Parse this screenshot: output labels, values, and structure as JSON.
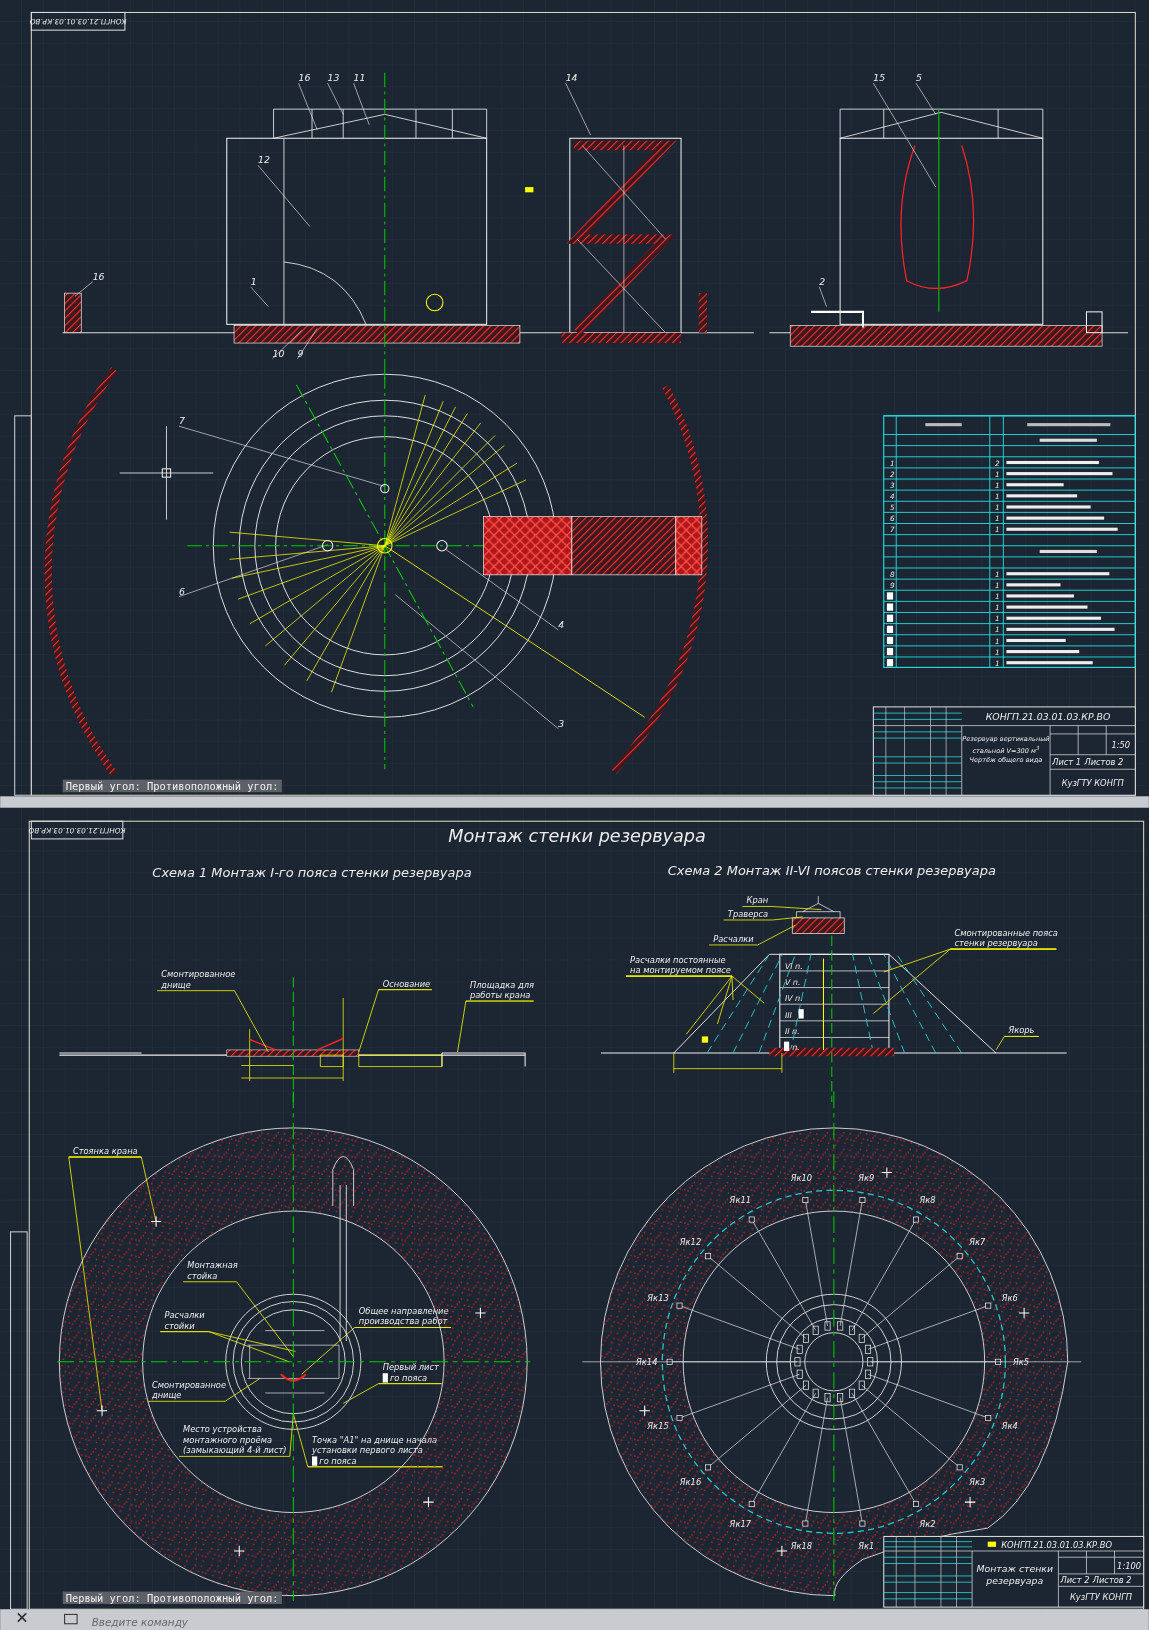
{
  "top_sheet": {
    "corner_stamp": "КОНГП.21.03.01.03.КР.ВО",
    "callouts": [
      "16",
      "13",
      "11",
      "14",
      "15",
      "5",
      "12",
      "1",
      "2",
      "16",
      "10",
      "9",
      "7",
      "6",
      "4",
      "3"
    ],
    "spec_table": {
      "rows": [
        {
          "kind": "header"
        },
        {
          "kind": "section"
        },
        {
          "kind": "blank"
        },
        {
          "kind": "item",
          "number": "1",
          "quantity": "2"
        },
        {
          "kind": "item",
          "number": "2",
          "quantity": "1"
        },
        {
          "kind": "item",
          "number": "3",
          "quantity": "1"
        },
        {
          "kind": "item",
          "number": "4",
          "quantity": "1"
        },
        {
          "kind": "item",
          "number": "5",
          "quantity": "1"
        },
        {
          "kind": "item",
          "number": "6",
          "quantity": "1"
        },
        {
          "kind": "item",
          "number": "7",
          "quantity": "1"
        },
        {
          "kind": "blank"
        },
        {
          "kind": "section"
        },
        {
          "kind": "blank"
        },
        {
          "kind": "item",
          "number": "8",
          "quantity": "1"
        },
        {
          "kind": "item",
          "number": "9",
          "quantity": "1"
        },
        {
          "kind": "masked",
          "quantity": "1"
        },
        {
          "kind": "masked",
          "quantity": "1"
        },
        {
          "kind": "masked",
          "quantity": "1"
        },
        {
          "kind": "masked",
          "quantity": "1"
        },
        {
          "kind": "masked",
          "quantity": "1"
        },
        {
          "kind": "masked",
          "quantity": "1"
        },
        {
          "kind": "masked",
          "quantity": "1"
        }
      ]
    },
    "title_block": {
      "code": "КОНГП.21.03.01.03.КР.ВО",
      "title": [
        "Резервуар вертикальный",
        "стальной V=300 м$^{3}$",
        "Чертёж общего вида"
      ],
      "scale": "1:50",
      "sheet": "Лист 1",
      "sheets": "Листов 2",
      "organization": "КузГТУ КОНГП"
    },
    "command_prompt": "Первый угол: Противоположный угол:"
  },
  "bottom_sheet": {
    "corner_stamp": "КОНГП.21.03.01.03.КР.ВО",
    "title": "Монтаж стенки резервуара",
    "scheme_1": {
      "title": "Схема 1 Монтаж I-го пояса стенки резервуара",
      "labels": [
        {
          "lines": [
            {
              "text": "Смонтированное",
              "masked": false
            },
            {
              "text": "днище",
              "masked": false
            }
          ]
        },
        {
          "lines": [
            {
              "text": "Основание",
              "masked": false
            }
          ]
        },
        {
          "lines": [
            {
              "text": "Площадка для",
              "masked": false
            },
            {
              "text": "работы крана",
              "masked": false
            }
          ]
        },
        {
          "lines": [
            {
              "text": "Стоянка крана",
              "masked": false
            }
          ]
        },
        {
          "lines": [
            {
              "text": "Монтажная",
              "masked": false
            },
            {
              "text": "стойка",
              "masked": false
            }
          ]
        },
        {
          "lines": [
            {
              "text": "Расчалки",
              "masked": false
            },
            {
              "text": "стойки",
              "masked": false
            }
          ]
        },
        {
          "lines": [
            {
              "text": "Общее направление",
              "masked": false
            },
            {
              "text": "производства работ",
              "masked": false
            }
          ]
        },
        {
          "lines": [
            {
              "text": "Смонтированное",
              "masked": false
            },
            {
              "text": "днище",
              "masked": false
            }
          ]
        },
        {
          "lines": [
            {
              "text": "Первый лист",
              "masked": false
            },
            {
              "text": "го пояса",
              "masked": true
            }
          ]
        },
        {
          "lines": [
            {
              "text": "Место устройства",
              "masked": false
            },
            {
              "text": "монтажного проёма",
              "masked": false
            },
            {
              "text": "(замыкающий 4-й лист)",
              "masked": false
            }
          ]
        },
        {
          "lines": [
            {
              "text": "Точка \"А1\" на днище начала",
              "masked": false
            },
            {
              "text": "установки первого листа",
              "masked": false
            },
            {
              "text": "го пояса",
              "masked": true
            }
          ]
        }
      ]
    },
    "scheme_2": {
      "title": "Схема 2 Монтаж II-VI поясов стенки резервуара",
      "labels": [
        {
          "lines": [
            {
              "text": "Кран",
              "masked": false
            }
          ]
        },
        {
          "lines": [
            {
              "text": "Траверса",
              "masked": false
            }
          ]
        },
        {
          "lines": [
            {
              "text": "Расчалки",
              "masked": false
            }
          ]
        },
        {
          "lines": [
            {
              "text": "Расчалки постоянные",
              "masked": false
            },
            {
              "text": "на монтируемом поясе",
              "masked": false
            }
          ]
        },
        {
          "lines": [
            {
              "text": "Смонтированные пояса",
              "masked": false
            },
            {
              "text": "стенки резервуара",
              "masked": false
            }
          ]
        },
        {
          "lines": [
            {
              "text": "Якорь",
              "masked": false
            }
          ]
        }
      ],
      "belts": [
        {
          "label": "VI п.",
          "masked_before": false,
          "masked_after": false
        },
        {
          "label": "V п.",
          "masked_before": false,
          "masked_after": false
        },
        {
          "label": "IV п.",
          "masked_before": false,
          "masked_after": false
        },
        {
          "label": "III",
          "masked_before": false,
          "masked_after": true
        },
        {
          "label": "II п.",
          "masked_before": false,
          "masked_after": false
        },
        {
          "label": "п.",
          "masked_before": true,
          "masked_after": false
        }
      ],
      "anchors": [
        "Як1",
        "Як2",
        "Як3",
        "Як4",
        "Як5",
        "Як6",
        "Як7",
        "Як8",
        "Як9",
        "Як10",
        "Як11",
        "Як12",
        "Як13",
        "Як14",
        "Як15",
        "Як16",
        "Як17",
        "Як18"
      ]
    },
    "title_block": {
      "code": "КОНГП.21.03.01.03.КР.ВО",
      "title": [
        "Монтаж стенки",
        "резервуара"
      ],
      "scale": "1:100",
      "sheet": "Лист 2",
      "sheets": "Листов 2",
      "organization": "КузГТУ КОНГП"
    },
    "command_prompt": "Первый угол: Противоположный угол:",
    "command_line": {
      "placeholder": "Введите команду"
    }
  }
}
